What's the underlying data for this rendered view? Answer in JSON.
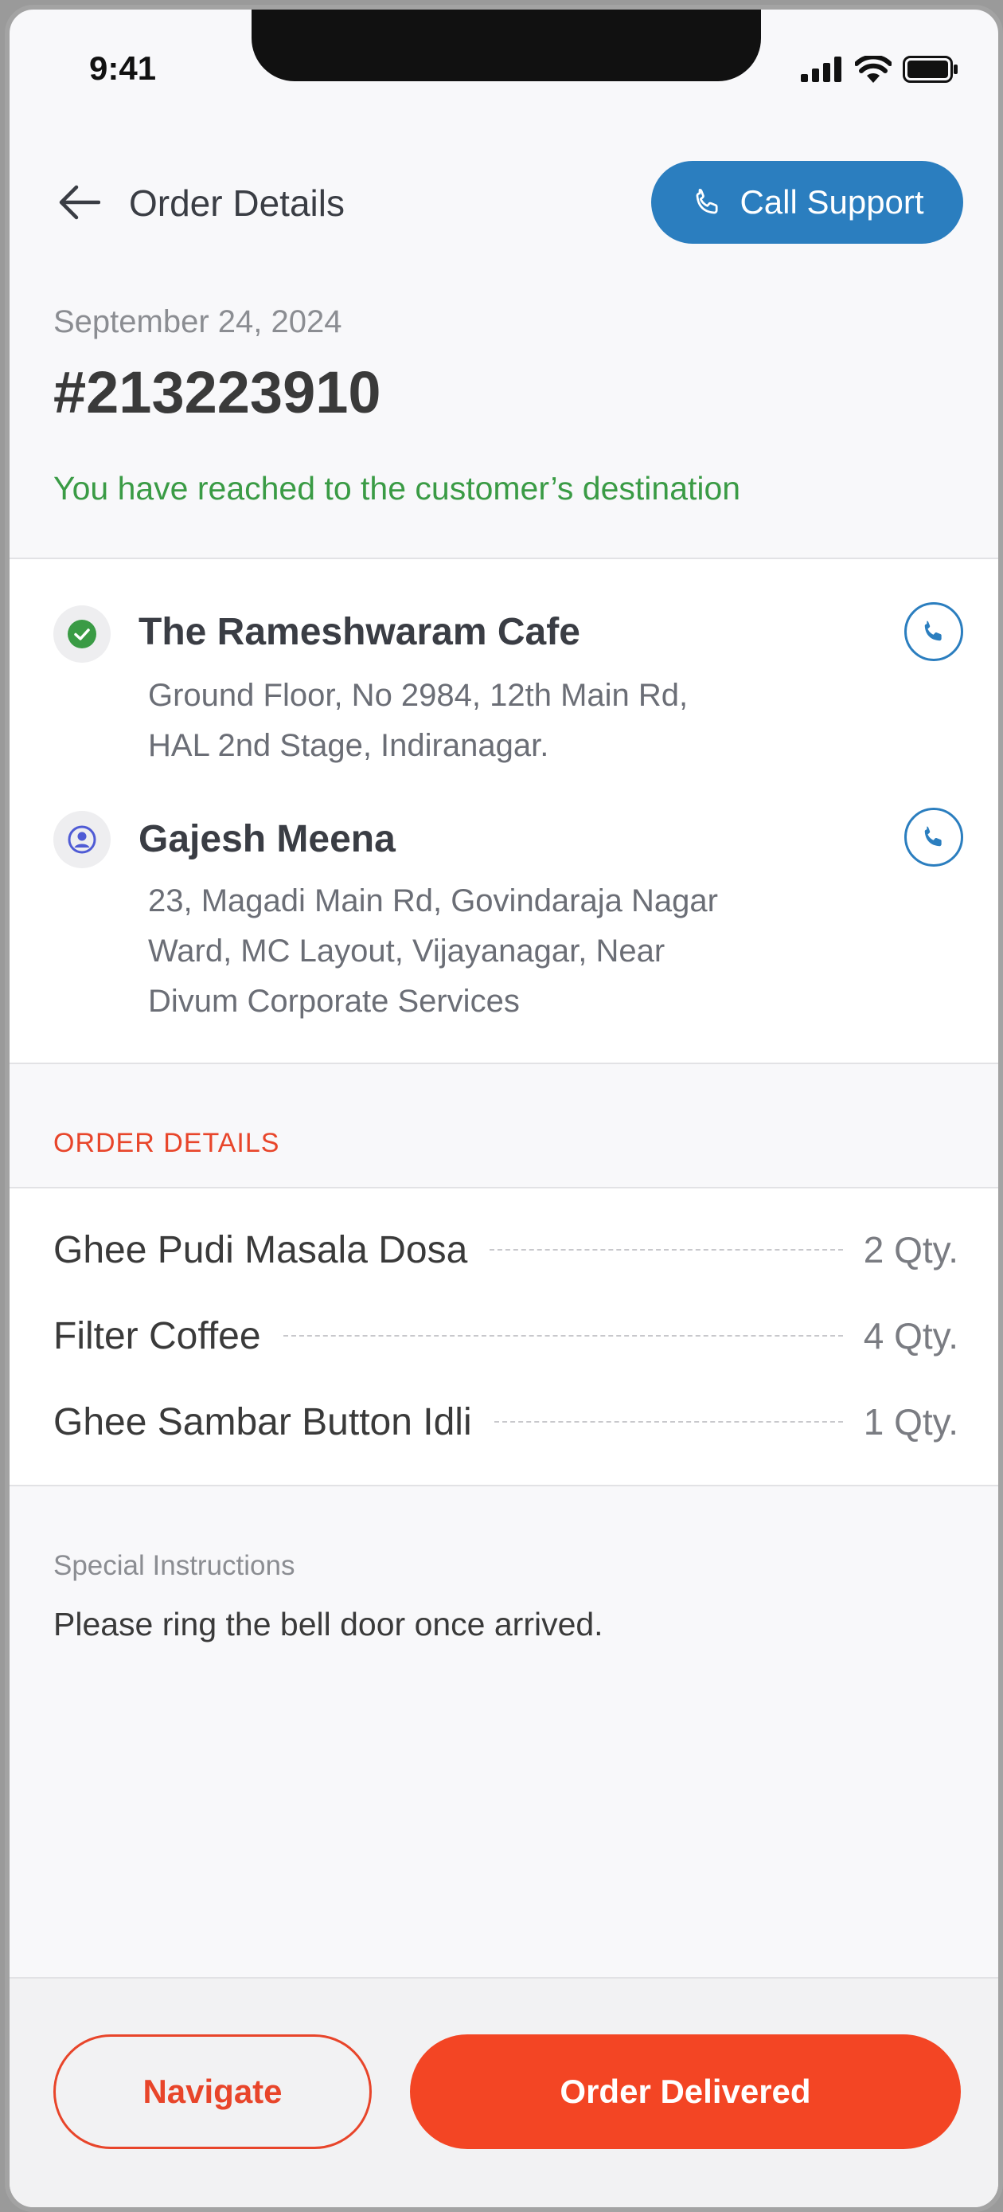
{
  "status_bar": {
    "time": "9:41"
  },
  "header": {
    "title": "Order Details",
    "call_support_label": "Call Support"
  },
  "order": {
    "date": "September 24, 2024",
    "id": "#213223910",
    "status_message": "You have reached to the customer’s destination"
  },
  "pickup": {
    "name": "The Rameshwaram Cafe",
    "address_lines": [
      "Ground Floor, No 2984, 12th Main Rd,",
      "HAL 2nd Stage, Indiranagar."
    ]
  },
  "dropoff": {
    "name": "Gajesh Meena",
    "address_lines": [
      "23, Magadi Main Rd, Govindaraja Nagar",
      "Ward, MC Layout, Vijayanagar, Near",
      "Divum Corporate Services"
    ]
  },
  "order_details": {
    "section_label": "ORDER DETAILS",
    "items": [
      {
        "name": "Ghee Pudi Masala Dosa",
        "qty": "2 Qty."
      },
      {
        "name": "Filter Coffee",
        "qty": "4 Qty."
      },
      {
        "name": "Ghee Sambar Button Idli",
        "qty": "1 Qty."
      }
    ]
  },
  "instructions": {
    "label": "Special Instructions",
    "text": "Please ring the bell door once arrived."
  },
  "footer": {
    "navigate_label": "Navigate",
    "delivered_label": "Order Delivered"
  },
  "colors": {
    "accent_blue": "#2b7ebf",
    "accent_orange": "#f34524",
    "success_green": "#3a9b45"
  },
  "icons": [
    "back-arrow-icon",
    "phone-icon",
    "check-circle-icon",
    "user-circle-icon",
    "signal-icon",
    "wifi-icon",
    "battery-icon"
  ]
}
